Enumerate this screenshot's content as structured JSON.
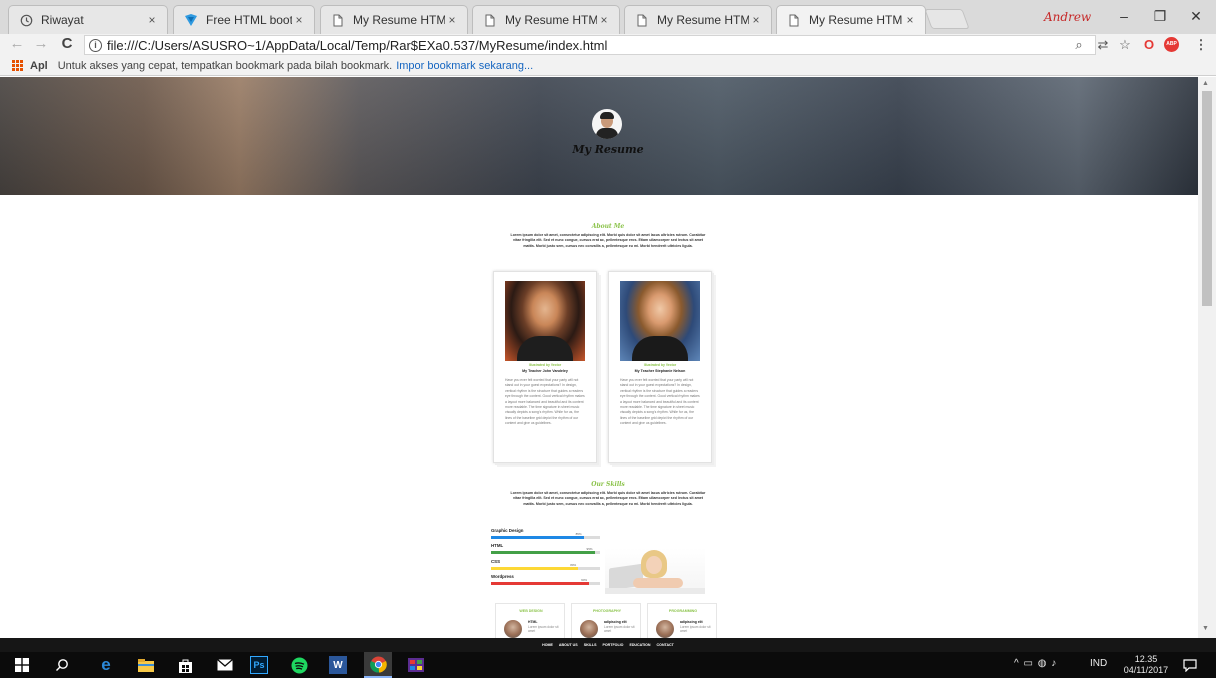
{
  "browser": {
    "tabs": [
      {
        "title": "Riwayat",
        "icon": "history-icon",
        "active": false
      },
      {
        "title": "Free HTML bootstrap te",
        "icon": "bootstrap-icon",
        "active": false
      },
      {
        "title": "My Resume HTML Boots",
        "icon": "document-icon",
        "active": false
      },
      {
        "title": "My Resume HTML Boots",
        "icon": "document-icon",
        "active": false
      },
      {
        "title": "My Resume HTML Boots",
        "icon": "document-icon",
        "active": false
      },
      {
        "title": "My Resume HTML Boots",
        "icon": "document-icon",
        "active": true
      }
    ],
    "tab_close": "×",
    "profile_name": "Andrew",
    "window_controls": {
      "minimize": "–",
      "maximize": "❐",
      "close": "✕"
    },
    "nav": {
      "back": "←",
      "forward": "→",
      "reload": "C"
    },
    "url": "file:///C:/Users/ASUSRO~1/AppData/Local/Temp/Rar$EXa0.537/MyResume/index.html",
    "toolbar_icons": {
      "zoom": "⌕",
      "translate": "⇄",
      "star": "☆",
      "opera": "O",
      "adblock": "ABP",
      "menu": "⋮"
    }
  },
  "bookmarks_bar": {
    "apps_label": "Apl",
    "message": "Untuk akses yang cepat, tempatkan bookmark pada bilah bookmark.",
    "import_link": "Impor bookmark sekarang..."
  },
  "page": {
    "brand": "My Resume",
    "about": {
      "title": "About Me",
      "text": "Lorem ipsum dolor sit amet, consectetur adipiscing elit. Morbi quis dolor sit amet lacus ultricies rutrum. Curabitur vitae fringilla elit. Sed et nunc congue, cursus erat ac, pellentesque eros. Etiam ullamcorper sed lectus sit amet mattis. Morbi justo sem, cursus nec convallis a, pellentesque eu mi. Morbi hendrerit ultricies ligula."
    },
    "teachers": [
      {
        "caption": "Illustrated by Vector",
        "name": "My Teacher John Vandeley",
        "bio": "Have you ever felt worried that your party will not stand out in your guest expectations? In design, vertical rhythm is the structure that guides a readers eye through the content. Good vertical rhythm makes a layout more balanced and beautiful and its content more readable. The time signature in sheet music visually depicts a song's rhythm. While for us, the lines of the baseline grid depict the rhythm of our content and give us guidelines."
      },
      {
        "caption": "Illustrated by Vector",
        "name": "My Teacher Stephanie Nelson",
        "bio": "Have you ever felt worried that your party will not stand out in your guest expectations? In design, vertical rhythm is the structure that guides a readers eye through the content. Good vertical rhythm makes a layout more balanced and beautiful and its content more readable. The time signature in sheet music visually depicts a song's rhythm. While for us, the lines of the baseline grid depict the rhythm of our content and give us guidelines."
      }
    ],
    "skills": {
      "title": "Our Skills",
      "text": "Lorem ipsum dolor sit amet, consectetur adipiscing elit. Morbi quis dolor sit amet lacus ultricies rutrum. Curabitur vitae fringilla elit. Sed et nunc congue, cursus erat ac, pellentesque eros. Etiam ullamcorper sed lectus sit amet mattis. Morbi justo sem, cursus nec convallis a, pellentesque eu mi. Morbi hendrerit ultricies ligula.",
      "items": [
        {
          "label": "Graphic Design",
          "percent": 85,
          "pct_label": "85%",
          "color": "#1e88e5"
        },
        {
          "label": "HTML",
          "percent": 95,
          "pct_label": "95%",
          "color": "#43a047"
        },
        {
          "label": "CSS",
          "percent": 80,
          "pct_label": "80%",
          "color": "#fdd835"
        },
        {
          "label": "Wordpress",
          "percent": 90,
          "pct_label": "90%",
          "color": "#e53935"
        }
      ]
    },
    "services": [
      {
        "title": "WEB DESIGN",
        "heading": "HTML",
        "text": "Lorem ipsum dolor sit amet"
      },
      {
        "title": "PHOTOGRAPHY",
        "heading": "adipiscing elit",
        "text": "Lorem ipsum dolor sit amet"
      },
      {
        "title": "PROGRAMMING",
        "heading": "adipiscing elit",
        "text": "Lorem ipsum dolor sit amet"
      }
    ],
    "menu": [
      "HOME",
      "ABOUT US",
      "SKILLS",
      "PORTFOLIO",
      "EDUCATION",
      "CONTACT"
    ]
  },
  "taskbar": {
    "apps": [
      "windows-start-icon",
      "search-icon",
      "edge-icon",
      "file-explorer-icon",
      "store-icon",
      "mail-icon",
      "photoshop-icon",
      "spotify-icon",
      "word-icon",
      "chrome-icon",
      "media-icon"
    ],
    "photoshop_label": "Ps",
    "word_label": "W",
    "tray_language": "IND",
    "tray_icons": "^  ▭  ◍  ♪",
    "time": "12.35",
    "date": "04/11/2017"
  }
}
